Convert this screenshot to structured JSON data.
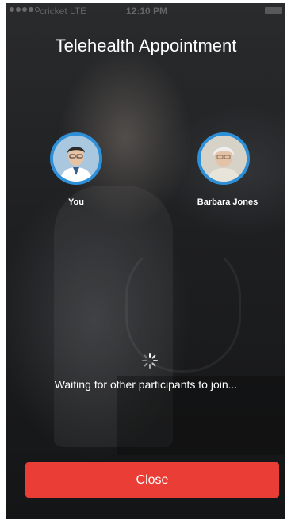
{
  "status_bar": {
    "carrier": "cricket",
    "network": "LTE",
    "time": "12:10 PM"
  },
  "header": {
    "title": "Telehealth Appointment"
  },
  "participants": [
    {
      "name": "You",
      "avatar_icon": "doctor-avatar-icon"
    },
    {
      "name": "Barbara Jones",
      "avatar_icon": "patient-avatar-icon"
    }
  ],
  "status": {
    "message": "Waiting for other participants to join...",
    "icon": "loading-spinner-icon"
  },
  "footer": {
    "close_label": "Close"
  },
  "colors": {
    "accent_border": "#2d8fd8",
    "close_button": "#ea3d35",
    "text": "#ffffff"
  }
}
